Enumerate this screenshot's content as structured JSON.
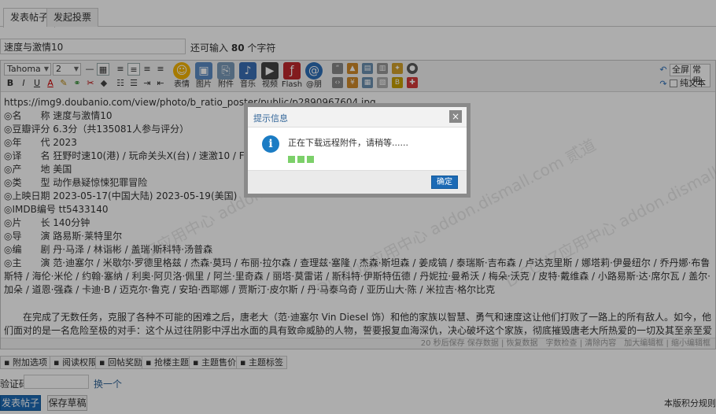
{
  "tabs": [
    {
      "label": "发表帖子",
      "active": true
    },
    {
      "label": "发起投票",
      "active": false
    }
  ],
  "title_input": {
    "value": "速度与激情10"
  },
  "char_hint": {
    "prefix": "还可输入",
    "count": "80",
    "suffix": "个字符"
  },
  "toolbar": {
    "font_family": "Tahoma",
    "font_size": "2",
    "big_buttons": [
      {
        "label": "表情",
        "icon": "smiley-icon",
        "color": "#f5b400"
      },
      {
        "label": "图片",
        "icon": "image-icon",
        "color": "#5a8bc4"
      },
      {
        "label": "附件",
        "icon": "attachment-icon",
        "color": "#7a9ab8"
      },
      {
        "label": "音乐",
        "icon": "music-icon",
        "color": "#3a6fb5"
      },
      {
        "label": "视频",
        "icon": "video-icon",
        "color": "#444444"
      },
      {
        "label": "Flash",
        "icon": "flash-icon",
        "color": "#c0282d"
      },
      {
        "label": "@朋",
        "icon": "at-icon",
        "color": "#2d6fb8"
      }
    ],
    "right": {
      "fullscreen": "全屏",
      "common": "常用",
      "plain_text": "纯文本"
    }
  },
  "content": {
    "lines": [
      "https://img9.doubanio.com/view/photo/b_ratio_poster/public/p2890967604.jpg",
      "◎名　　称 速度与激情10",
      "◎豆瓣评分 6.3分（共135081人参与评分）",
      "◎年　　代 2023",
      "◎译　　名 狂野时速10(港) / 玩命关头X(台) / 速激10 / Fast & Furious 10 / Fast X",
      "◎产　　地 美国",
      "◎类　　型 动作悬疑惊悚犯罪冒险",
      "◎上映日期 2023-05-17(中国大陆) 2023-05-19(美国)",
      "◎IMDB编号 tt5433140",
      "◎片　　长 140分钟",
      "◎导　　演 路易斯·莱特里尔",
      "◎编　　剧 丹·马泽 / 林诣彬 / 盖瑞·斯科特·汤普森"
    ],
    "cast": "◎主　　演 范·迪塞尔 / 米歇尔·罗德里格兹 / 杰森·莫玛 / 布丽·拉尔森 / 查理兹·塞隆 / 杰森·斯坦森 / 姜成镐 / 泰瑞斯·吉布森 / 卢达克里斯 / 娜塔莉·伊曼纽尔 / 乔丹娜·布鲁斯特 / 海伦·米伦 / 约翰·塞纳 / 利奥·阿贝洛·佩里 / 阿兰·里奇森 / 丽塔·莫雷诺 / 斯科特·伊斯特伍德 / 丹妮拉·曼希沃 / 梅朵·沃克 / 皮特·戴维森 / 小路易斯·达·席尔瓦 / 盖尔·加朵 / 道恩·强森 / 卡迪·B / 迈克尔·鲁克 / 安珀·西耶娜 / 贾斯汀·皮尔斯 / 丹·马泰乌奇 / 亚历山大·陈 / 米拉吉·格尔比克",
    "paragraph": "在完成了无数任务，克服了各种不可能的困难之后，唐老大（范·迪塞尔 Vin Diesel 饰）和他的家族以智慧、勇气和速度这让他们打败了一路上的所有敌人。如今，他们面对的是一名危险至极的对手：这个从过往阴影中浮出水面的具有致命威胁的人物，誓要报复血海深仇，决心破坏这个家族，彻底摧毁唐老大所热爱的一切及其至亲至爱之人。"
  },
  "status_bar": "20 秒后保存 保存数据 | 恢复数据　字数检查 | 清除内容　加大编辑框 | 缩小编辑框",
  "options": [
    "附加选项",
    "阅读权限",
    "回帖奖励",
    "抢楼主题",
    "主题售价",
    "主题标签"
  ],
  "captcha": {
    "label": "验证码",
    "change": "换一个"
  },
  "buttons": {
    "submit": "发表帖子",
    "draft": "保存草稿"
  },
  "rules_link": "本版积分规则",
  "watermark": "DISCUZ应用中心 addon.dismall.com 贰道",
  "dialog": {
    "title": "提示信息",
    "close": "×",
    "message": "正在下载远程附件，请稍等......",
    "ok": "确定"
  }
}
